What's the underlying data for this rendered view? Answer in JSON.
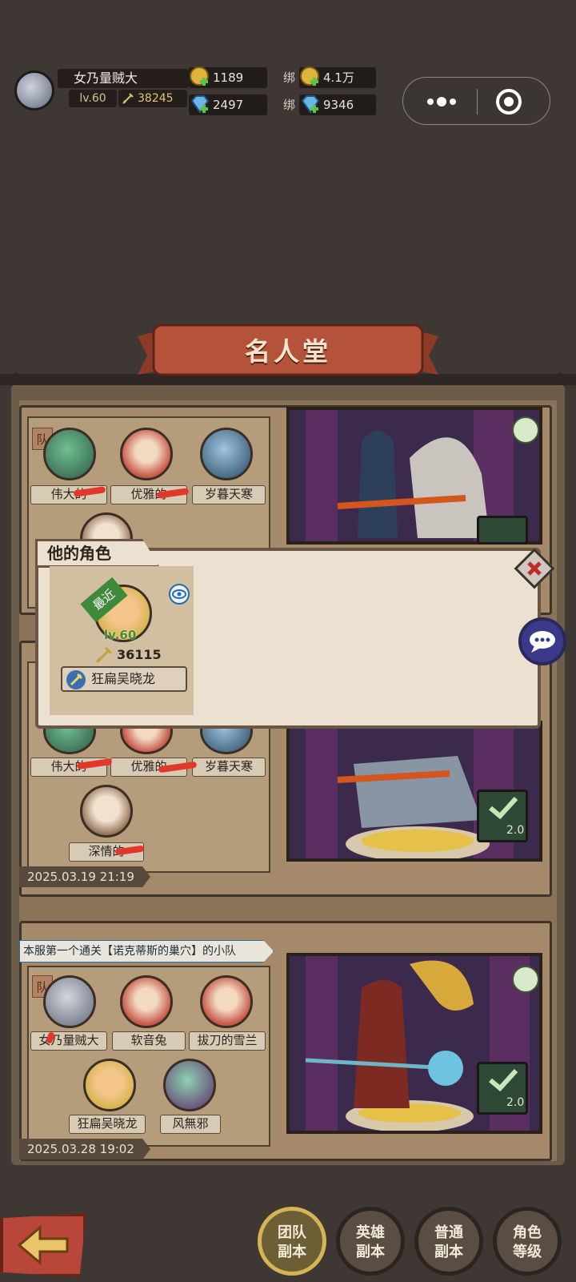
{
  "player": {
    "name": "女乃量贼大",
    "level": "lv.60",
    "power": "38245"
  },
  "currency": {
    "gold": "1189",
    "diamond": "2497",
    "bound_prefix": "绑",
    "bound_gold": "4.1万",
    "bound_diamond": "9346"
  },
  "hall": {
    "title": "名人堂"
  },
  "cards": [
    {
      "members": [
        "伟大的",
        "优雅的",
        "岁暮天寒"
      ],
      "tag": "队"
    },
    {
      "members": [
        "伟大的",
        "优雅的",
        "岁暮天寒",
        "深情的"
      ],
      "date": "2025.03.19 21:19",
      "check_count": "2.0"
    },
    {
      "banner": "本服第一个通关【诺克蒂斯的巢穴】的小队",
      "tag": "队",
      "members": [
        "女乃量贼大",
        "软音兔",
        "拔刀的雪兰",
        "狂扁吴晓龙",
        "风無邪"
      ],
      "date": "2025.03.28 19:02",
      "check_count": "2.0"
    }
  ],
  "popup": {
    "tab_title": "他的角色",
    "recent_badge": "最近",
    "hero_level": "lv.60",
    "hero_power": "36115",
    "hero_name": "狂扁吴晓龙"
  },
  "bottom_nav": [
    {
      "label1": "团队",
      "label2": "副本"
    },
    {
      "label1": "英雄",
      "label2": "副本"
    },
    {
      "label1": "普通",
      "label2": "副本"
    },
    {
      "label1": "角色",
      "label2": "等级"
    }
  ],
  "colors": {
    "background": "#3e3733",
    "banner": "#b5533a",
    "accent_green": "#3e8a3a"
  }
}
